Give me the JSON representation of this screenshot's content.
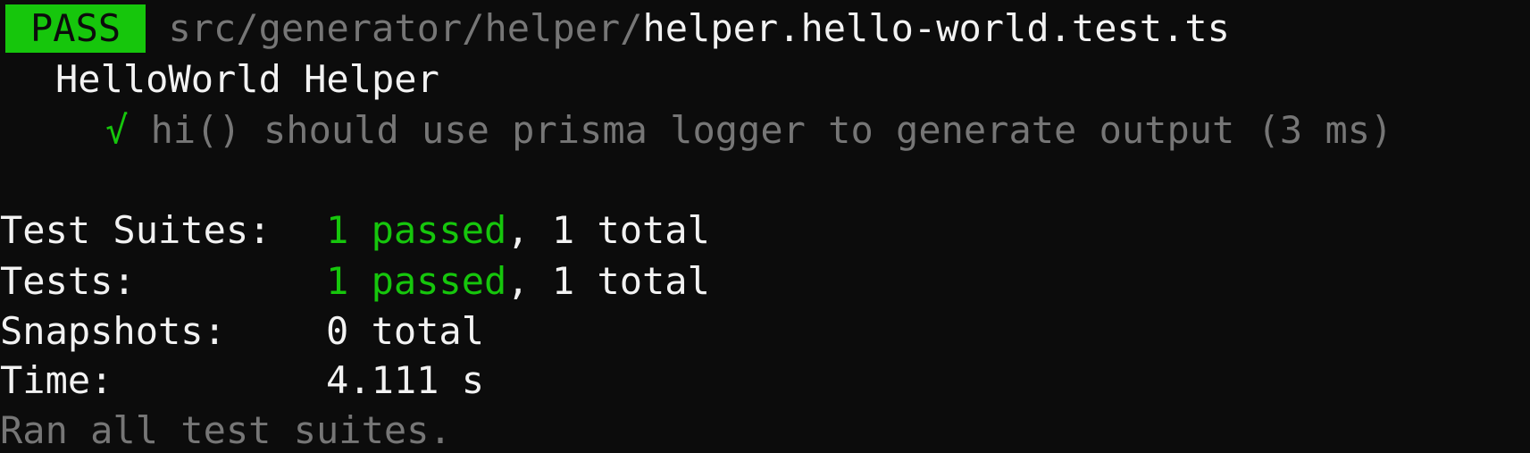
{
  "result": {
    "status_badge": "PASS",
    "path_dir": "src/generator/helper/",
    "path_file": "helper.hello-world.test.ts"
  },
  "suite": {
    "name": "HelloWorld Helper",
    "tests": [
      {
        "check": "√",
        "text": "hi() should use prisma logger to generate output (3 ms)"
      }
    ]
  },
  "summary": {
    "suites_label": "Test Suites:",
    "suites_passed": "1 passed",
    "suites_total": ", 1 total",
    "tests_label": "Tests:",
    "tests_passed": "1 passed",
    "tests_total": ", 1 total",
    "snapshots_label": "Snapshots:",
    "snapshots_value": "0 total",
    "time_label": "Time:",
    "time_value": "4.111 s",
    "footer": "Ran all test suites."
  },
  "colors": {
    "background": "#0c0c0c",
    "pass_green": "#16c60c",
    "dim_gray": "#767676",
    "bright_white": "#f2f2f2"
  }
}
